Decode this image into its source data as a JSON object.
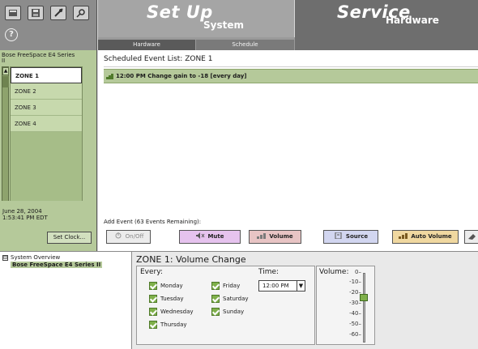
{
  "header": {
    "setup_title": "Set Up",
    "setup_subtitle": "System",
    "service_title": "Service",
    "service_subtitle": "Hardware",
    "tabs": [
      {
        "label": "Hardware"
      },
      {
        "label": "Schedule"
      }
    ]
  },
  "toolbar": {
    "icons": [
      "app-menu-icon",
      "save-icon",
      "wrench-icon",
      "search-icon"
    ],
    "help_label": "?"
  },
  "sidebar": {
    "device_label": "Bose FreeSpace E4 Series II",
    "zones": [
      {
        "label": "ZONE 1",
        "selected": true
      },
      {
        "label": "ZONE 2",
        "selected": false
      },
      {
        "label": "ZONE 3",
        "selected": false
      },
      {
        "label": "ZONE 4",
        "selected": false
      }
    ],
    "clock_date": "June 28, 2004",
    "clock_time": "1:53:41 PM EDT",
    "set_clock_label": "Set Clock..."
  },
  "main": {
    "list_title": "Scheduled Event List: ZONE 1",
    "events": [
      {
        "text": "12:00 PM Change gain to -18 [every day]"
      }
    ],
    "add_event_label": "Add Event (63 Events Remaining):",
    "buttons": {
      "onoff": "On/Off",
      "mute": "Mute",
      "volume": "Volume",
      "source": "Source",
      "auto_volume": "Auto Volume"
    }
  },
  "tree": {
    "root": "System Overview",
    "child": "Bose FreeSpace E4 Series II",
    "expander": "⊟"
  },
  "detail": {
    "title": "ZONE 1:  Volume Change",
    "every_label": "Every:",
    "days": [
      {
        "label": "Monday",
        "checked": true
      },
      {
        "label": "Tuesday",
        "checked": true
      },
      {
        "label": "Wednesday",
        "checked": true
      },
      {
        "label": "Thursday",
        "checked": true
      },
      {
        "label": "Friday",
        "checked": true
      },
      {
        "label": "Saturday",
        "checked": true
      },
      {
        "label": "Sunday",
        "checked": true
      }
    ],
    "time_label": "Time:",
    "time_value": "12:00 PM",
    "time_spin": "▼",
    "volume_label": "Volume:",
    "volume_ticks": [
      "0–",
      "-10–",
      "-20–",
      "-30–",
      "-40–",
      "-50–",
      "-60–"
    ],
    "volume_value_db": -18,
    "volume_min_db": -60,
    "volume_max_db": 0
  },
  "colors": {
    "sidebar_green": "#b5c99a",
    "event_row_green": "#b5c99a",
    "checkbox_green": "#7fb04a",
    "mute_btn": "#e6c3ee",
    "volume_btn": "#e8c4c4",
    "source_btn": "#d2d6f0",
    "auto_volume_btn": "#f0d8a0"
  }
}
